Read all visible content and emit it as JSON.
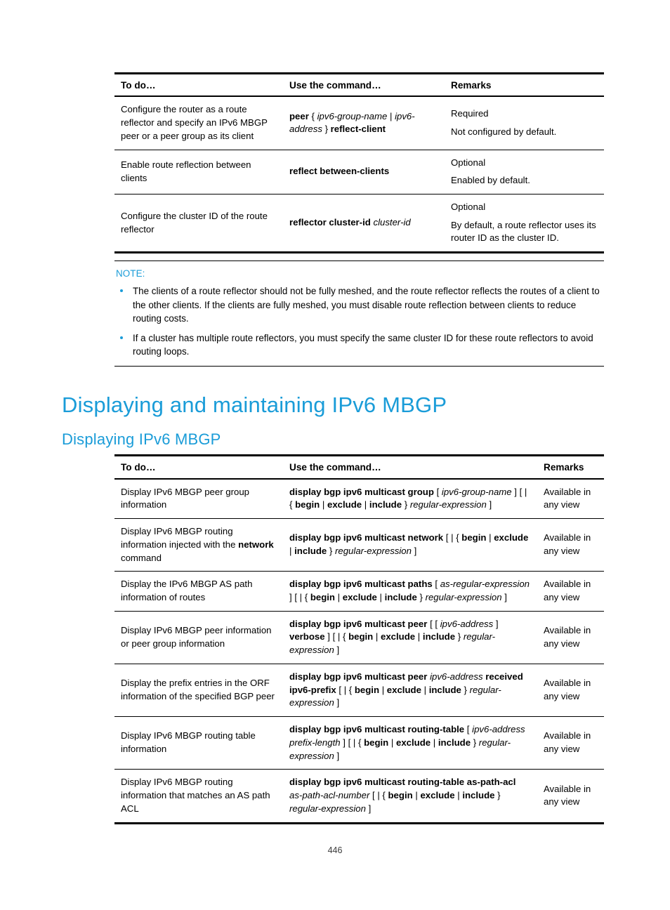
{
  "colors": {
    "heading_blue": "#1a9cd8",
    "rule_black": "#000000"
  },
  "table_reflector": {
    "headers": [
      "To do…",
      "Use the command…",
      "Remarks"
    ],
    "rows": [
      {
        "todo": "Configure the router as a route reflector and specify an IPv6 MBGP peer or a peer group as its client",
        "command_parts": [
          {
            "text": "peer",
            "style": "bold"
          },
          {
            "text": " { ",
            "style": "plain"
          },
          {
            "text": "ipv6-group-name",
            "style": "italic"
          },
          {
            "text": " | ",
            "style": "plain"
          },
          {
            "text": "ipv6-address",
            "style": "italic"
          },
          {
            "text": " } ",
            "style": "plain"
          },
          {
            "text": "reflect-client",
            "style": "bold"
          }
        ],
        "remarks": [
          "Required",
          "Not configured by default."
        ]
      },
      {
        "todo": "Enable route reflection between clients",
        "command_parts": [
          {
            "text": "reflect between-clients",
            "style": "bold"
          }
        ],
        "remarks": [
          "Optional",
          "Enabled by default."
        ]
      },
      {
        "todo": "Configure the cluster ID of the route reflector",
        "command_parts": [
          {
            "text": "reflector cluster-id",
            "style": "bold"
          },
          {
            "text": " ",
            "style": "plain"
          },
          {
            "text": "cluster-id",
            "style": "italic"
          }
        ],
        "remarks": [
          "Optional",
          "By default, a route reflector uses its router ID as the cluster ID."
        ]
      }
    ]
  },
  "note": {
    "label": "NOTE:",
    "items": [
      "The clients of a route reflector should not be fully meshed, and the route reflector reflects the routes of a client to the other clients. If the clients are fully meshed, you must disable route reflection between clients to reduce routing costs.",
      "If a cluster has multiple route reflectors, you must specify the same cluster ID for these route reflectors to avoid routing loops."
    ]
  },
  "headings": {
    "h1": "Displaying and maintaining IPv6 MBGP",
    "h2": "Displaying IPv6 MBGP"
  },
  "table_display": {
    "headers": [
      "To do…",
      "Use the command…",
      "Remarks"
    ],
    "rows": [
      {
        "todo_parts": [
          {
            "text": "Display IPv6 MBGP peer group information",
            "style": "plain"
          }
        ],
        "command_parts": [
          {
            "text": "display bgp ipv6 multicast group",
            "style": "bold"
          },
          {
            "text": " [ ",
            "style": "plain"
          },
          {
            "text": "ipv6-group-name",
            "style": "italic"
          },
          {
            "text": " ] [ | { ",
            "style": "plain"
          },
          {
            "text": "begin",
            "style": "bold"
          },
          {
            "text": " | ",
            "style": "plain"
          },
          {
            "text": "exclude",
            "style": "bold"
          },
          {
            "text": " | ",
            "style": "plain"
          },
          {
            "text": "include",
            "style": "bold"
          },
          {
            "text": " } ",
            "style": "plain"
          },
          {
            "text": "regular-expression",
            "style": "italic"
          },
          {
            "text": " ]",
            "style": "plain"
          }
        ],
        "remarks": [
          "Available in any view"
        ]
      },
      {
        "todo_parts": [
          {
            "text": "Display IPv6 MBGP routing information injected with the ",
            "style": "plain"
          },
          {
            "text": "network",
            "style": "bold"
          },
          {
            "text": " command",
            "style": "plain"
          }
        ],
        "command_parts": [
          {
            "text": "display bgp ipv6 multicast network",
            "style": "bold"
          },
          {
            "text": " [ | { ",
            "style": "plain"
          },
          {
            "text": "begin",
            "style": "bold"
          },
          {
            "text": " | ",
            "style": "plain"
          },
          {
            "text": "exclude",
            "style": "bold"
          },
          {
            "text": " | ",
            "style": "plain"
          },
          {
            "text": "include",
            "style": "bold"
          },
          {
            "text": " } ",
            "style": "plain"
          },
          {
            "text": "regular-expression",
            "style": "italic"
          },
          {
            "text": " ]",
            "style": "plain"
          }
        ],
        "remarks": [
          "Available in any view"
        ]
      },
      {
        "todo_parts": [
          {
            "text": "Display the IPv6 MBGP AS path information of routes",
            "style": "plain"
          }
        ],
        "command_parts": [
          {
            "text": "display bgp ipv6 multicast paths",
            "style": "bold"
          },
          {
            "text": " [ ",
            "style": "plain"
          },
          {
            "text": "as-regular-expression",
            "style": "italic"
          },
          {
            "text": " ] [ | { ",
            "style": "plain"
          },
          {
            "text": "begin",
            "style": "bold"
          },
          {
            "text": " | ",
            "style": "plain"
          },
          {
            "text": "exclude",
            "style": "bold"
          },
          {
            "text": " | ",
            "style": "plain"
          },
          {
            "text": "include",
            "style": "bold"
          },
          {
            "text": " } ",
            "style": "plain"
          },
          {
            "text": "regular-expression",
            "style": "italic"
          },
          {
            "text": " ]",
            "style": "plain"
          }
        ],
        "remarks": [
          "Available in any view"
        ]
      },
      {
        "todo_parts": [
          {
            "text": "Display IPv6 MBGP peer information or peer group information",
            "style": "plain"
          }
        ],
        "command_parts": [
          {
            "text": "display bgp ipv6 multicast peer",
            "style": "bold"
          },
          {
            "text": " [ [ ",
            "style": "plain"
          },
          {
            "text": "ipv6-address",
            "style": "italic"
          },
          {
            "text": " ] ",
            "style": "plain"
          },
          {
            "text": "verbose",
            "style": "bold"
          },
          {
            "text": " ] [ | { ",
            "style": "plain"
          },
          {
            "text": "begin",
            "style": "bold"
          },
          {
            "text": " | ",
            "style": "plain"
          },
          {
            "text": "exclude",
            "style": "bold"
          },
          {
            "text": " | ",
            "style": "plain"
          },
          {
            "text": "include",
            "style": "bold"
          },
          {
            "text": " } ",
            "style": "plain"
          },
          {
            "text": "regular-expression",
            "style": "italic"
          },
          {
            "text": " ]",
            "style": "plain"
          }
        ],
        "remarks": [
          "Available in any view"
        ]
      },
      {
        "todo_parts": [
          {
            "text": "Display the prefix entries in the ORF information of the specified BGP peer",
            "style": "plain"
          }
        ],
        "command_parts": [
          {
            "text": "display bgp ipv6 multicast peer",
            "style": "bold"
          },
          {
            "text": " ",
            "style": "plain"
          },
          {
            "text": "ipv6-address",
            "style": "italic"
          },
          {
            "text": " ",
            "style": "plain"
          },
          {
            "text": "received ipv6-prefix",
            "style": "bold"
          },
          {
            "text": " [ | { ",
            "style": "plain"
          },
          {
            "text": "begin",
            "style": "bold"
          },
          {
            "text": " | ",
            "style": "plain"
          },
          {
            "text": "exclude",
            "style": "bold"
          },
          {
            "text": " | ",
            "style": "plain"
          },
          {
            "text": "include",
            "style": "bold"
          },
          {
            "text": " } ",
            "style": "plain"
          },
          {
            "text": "regular-expression",
            "style": "italic"
          },
          {
            "text": " ]",
            "style": "plain"
          }
        ],
        "remarks": [
          "Available in any view"
        ]
      },
      {
        "todo_parts": [
          {
            "text": "Display IPv6 MBGP routing table information",
            "style": "plain"
          }
        ],
        "command_parts": [
          {
            "text": "display bgp ipv6 multicast routing-table",
            "style": "bold"
          },
          {
            "text": " [ ",
            "style": "plain"
          },
          {
            "text": "ipv6-address prefix-length",
            "style": "italic"
          },
          {
            "text": " ] [ | { ",
            "style": "plain"
          },
          {
            "text": "begin",
            "style": "bold"
          },
          {
            "text": " | ",
            "style": "plain"
          },
          {
            "text": "exclude",
            "style": "bold"
          },
          {
            "text": " | ",
            "style": "plain"
          },
          {
            "text": "include",
            "style": "bold"
          },
          {
            "text": " } ",
            "style": "plain"
          },
          {
            "text": "regular-expression",
            "style": "italic"
          },
          {
            "text": " ]",
            "style": "plain"
          }
        ],
        "remarks": [
          "Available in any view"
        ]
      },
      {
        "todo_parts": [
          {
            "text": "Display IPv6 MBGP routing information that matches an AS path ACL",
            "style": "plain"
          }
        ],
        "command_parts": [
          {
            "text": "display bgp ipv6 multicast routing-table as-path-acl",
            "style": "bold"
          },
          {
            "text": " ",
            "style": "plain"
          },
          {
            "text": "as-path-acl-number",
            "style": "italic"
          },
          {
            "text": " [ | { ",
            "style": "plain"
          },
          {
            "text": "begin",
            "style": "bold"
          },
          {
            "text": " | ",
            "style": "plain"
          },
          {
            "text": "exclude",
            "style": "bold"
          },
          {
            "text": " | ",
            "style": "plain"
          },
          {
            "text": "include",
            "style": "bold"
          },
          {
            "text": " } ",
            "style": "plain"
          },
          {
            "text": "regular-expression",
            "style": "italic"
          },
          {
            "text": " ]",
            "style": "plain"
          }
        ],
        "remarks": [
          "Available in any view"
        ]
      }
    ]
  },
  "footer": {
    "page_number": "446"
  }
}
